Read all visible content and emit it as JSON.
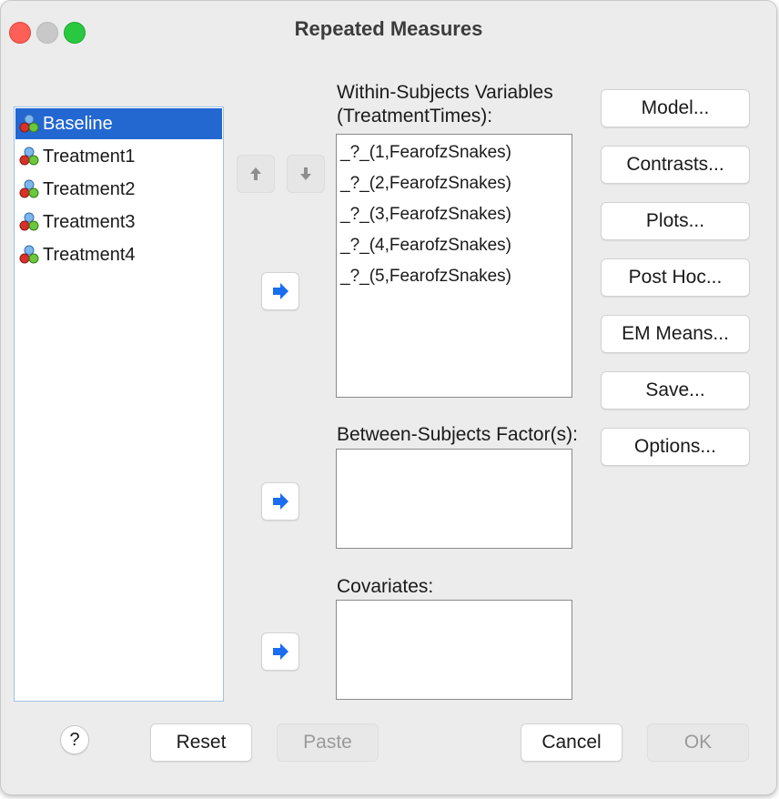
{
  "window": {
    "title": "Repeated Measures"
  },
  "variables": [
    {
      "label": "Baseline",
      "selected": true
    },
    {
      "label": "Treatment1",
      "selected": false
    },
    {
      "label": "Treatment2",
      "selected": false
    },
    {
      "label": "Treatment3",
      "selected": false
    },
    {
      "label": "Treatment4",
      "selected": false
    }
  ],
  "within": {
    "label_line1": "Within-Subjects Variables",
    "label_line2": "(TreatmentTimes):",
    "items": [
      "_?_(1,FearofzSnakes)",
      "_?_(2,FearofzSnakes)",
      "_?_(3,FearofzSnakes)",
      "_?_(4,FearofzSnakes)",
      "_?_(5,FearofzSnakes)"
    ]
  },
  "between": {
    "label": "Between-Subjects Factor(s):"
  },
  "covariates": {
    "label": "Covariates:"
  },
  "side_buttons": {
    "model": "Model...",
    "contrasts": "Contrasts...",
    "plots": "Plots...",
    "post_hoc": "Post Hoc...",
    "em_means": "EM Means...",
    "save": "Save...",
    "options": "Options..."
  },
  "bottom_buttons": {
    "help": "?",
    "reset": "Reset",
    "paste": "Paste",
    "cancel": "Cancel",
    "ok": "OK"
  },
  "icons": {
    "variable": "scale-variable-icon",
    "move_right": "arrow-right-icon",
    "move_up": "arrow-up-icon",
    "move_down": "arrow-down-icon"
  },
  "colors": {
    "selection": "#2367d1",
    "arrow_blue": "#1a6cf0",
    "close": "#fe5f57",
    "zoom": "#28c840"
  }
}
